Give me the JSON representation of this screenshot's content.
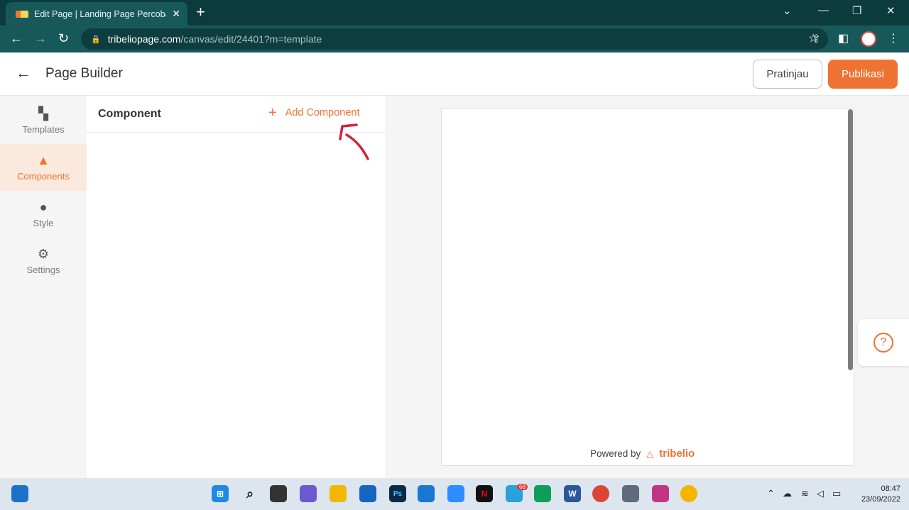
{
  "browser": {
    "tab_title": "Edit Page | Landing Page Percoba",
    "new_tab": "+",
    "url_host": "tribeliopage.com",
    "url_path": "/canvas/edit/24401?m=template"
  },
  "header": {
    "title": "Page Builder",
    "preview_label": "Pratinjau",
    "publish_label": "Publikasi"
  },
  "sidebar": {
    "items": [
      {
        "label": "Templates",
        "icon": "templates-icon"
      },
      {
        "label": "Components",
        "icon": "components-icon"
      },
      {
        "label": "Style",
        "icon": "palette-icon"
      },
      {
        "label": "Settings",
        "icon": "gear-icon"
      }
    ]
  },
  "panel": {
    "title": "Component",
    "add_label": "Add Component"
  },
  "canvas": {
    "powered_by": "Powered by",
    "brand": "tribelio"
  },
  "help": {
    "label": "?"
  },
  "taskbar": {
    "time": "08:47",
    "date": "23/09/2022",
    "badge": "68"
  },
  "colors": {
    "accent": "#ee7231",
    "chrome": "#17595b"
  }
}
